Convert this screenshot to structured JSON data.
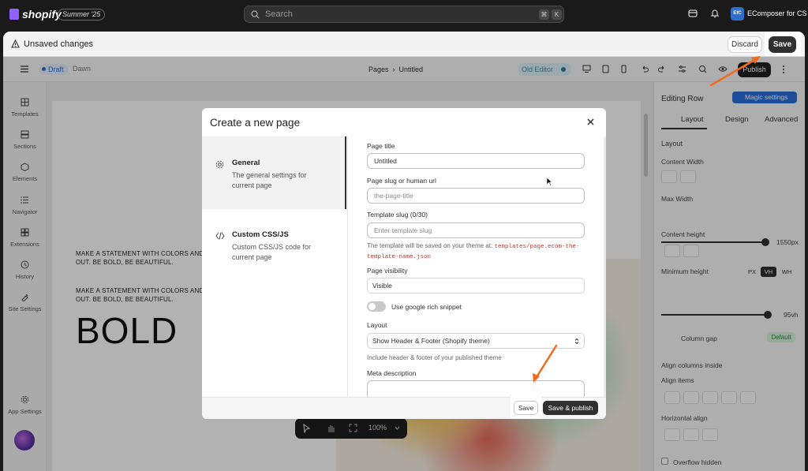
{
  "shopify": {
    "logo_text": "shopify",
    "edition": "Summer '25",
    "search_placeholder": "Search",
    "shortcut_keys": [
      "⌘",
      "K"
    ],
    "store_avatar": "EfC",
    "store_name": "EComposer for CS"
  },
  "unsaved_bar": {
    "message": "Unsaved changes",
    "discard_label": "Discard",
    "save_label": "Save"
  },
  "builder_toolbar": {
    "status": "Draft",
    "theme": "Dawn",
    "breadcrumb": "Pages  ›  Untitled",
    "old_editor_label": "Old Editor",
    "publish_label": "Publish"
  },
  "left_rail": {
    "items": [
      "Templates",
      "Sections",
      "Elements",
      "Navigator",
      "Extensions",
      "History",
      "Site Settings"
    ],
    "app_settings": "App Settings"
  },
  "canvas": {
    "statement_1": "MAKE A STATEMENT WITH COLORS AND CU",
    "statement_1b": "OUT. BE BOLD, BE BEAUTIFUL.",
    "statement_2": "MAKE A STATEMENT WITH COLORS AND CU",
    "statement_2b": "OUT. BE BOLD, BE BEAUTIFUL.",
    "headline": "BOLD",
    "zoom": "100%"
  },
  "right_panel": {
    "title": "Editing Row",
    "magic_label": "Magic settings",
    "tabs": [
      "Layout",
      "Design",
      "Advanced"
    ],
    "section_layout": "Layout",
    "content_width": "Content Width",
    "max_width": "Max Width",
    "max_width_value": "1550px",
    "content_height": "Content height",
    "min_height": "Minimum height",
    "units": [
      "PX",
      "VH",
      "WH"
    ],
    "min_height_value": "95vh",
    "column_gap": "Column gap",
    "column_gap_value": "Default",
    "align_columns": "Align columns inside",
    "align_items": "Align items",
    "horizontal_align": "Horizontal align",
    "overflow_hidden": "Overflow hidden"
  },
  "modal": {
    "title": "Create a new page",
    "nav": [
      {
        "title": "General",
        "desc": "The general settings for current page"
      },
      {
        "title": "Custom CSS/JS",
        "desc": "Custom CSS/JS code for current page"
      }
    ],
    "page_title_label": "Page title",
    "page_title_value": "Untitled",
    "slug_label": "Page slug or human url",
    "slug_placeholder": "the-page-title",
    "template_label": "Template slug (0/30)",
    "template_placeholder": "Enter template slug",
    "hint_prefix": "The template will be saved on your theme at:",
    "hint_code": "templates/page.ecom-the-template-name.json",
    "visibility_label": "Page visibility",
    "visibility_value": "Visible",
    "rich_snippet_label": "Use google rich snippet",
    "layout_label": "Layout",
    "layout_value": "Show Header & Footer (Shopify theme)",
    "layout_hint": "Include header & footer of your published theme",
    "meta_label": "Meta description",
    "save_label": "Save",
    "save_publish_label": "Save & publish"
  },
  "annotation_color": "#f26b1d"
}
